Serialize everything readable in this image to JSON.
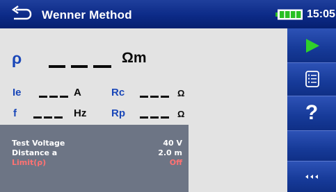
{
  "header": {
    "back_icon": "back-arrow-icon",
    "title": "Wenner Method",
    "battery_icon": "battery-full-icon",
    "battery_color": "#29c024",
    "time": "15:05"
  },
  "measurement": {
    "rho": {
      "symbol": "ρ",
      "unit": "Ωm"
    },
    "ie": {
      "label": "Ie",
      "unit": "A"
    },
    "rc": {
      "label": "Rc",
      "unit": "Ω"
    },
    "f": {
      "label": "f",
      "unit": "Hz"
    },
    "rp": {
      "label": "Rp",
      "unit": "Ω"
    }
  },
  "parameters": [
    {
      "label": "Test Voltage",
      "value": "40 V"
    },
    {
      "label": "Distance a",
      "value": "2.0 m"
    },
    {
      "label": "Limit(ρ)",
      "value": "Off"
    }
  ],
  "sidebar": {
    "start_icon": "play-icon",
    "start_color": "#2fd12b",
    "settings_icon": "list-icon",
    "help_label": "?",
    "more_icon": "triple-chevron-left-icon"
  },
  "colors": {
    "header_bg": "#0c2a87",
    "label_blue": "#1a47b8",
    "panel_bg": "#6d7585",
    "limit_red": "#ff7272"
  }
}
